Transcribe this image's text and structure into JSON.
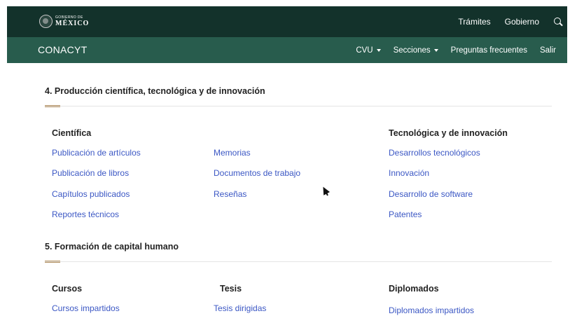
{
  "header": {
    "logo_small": "GOBIERNO DE",
    "logo_big": "MÉXICO",
    "links": [
      "Trámites",
      "Gobierno"
    ]
  },
  "subheader": {
    "brand": "CONACYT",
    "nav": [
      {
        "label": "CVU",
        "dropdown": true
      },
      {
        "label": "Secciones",
        "dropdown": true
      },
      {
        "label": "Preguntas frecuentes",
        "dropdown": false
      },
      {
        "label": "Salir",
        "dropdown": false
      }
    ]
  },
  "section4": {
    "title": "4. Producción científica, tecnológica y de innovación",
    "col_cientifica": "Científica",
    "col_tecnologica": "Tecnológica y de innovación",
    "links_col1": [
      "Publicación de artículos",
      "Publicación de libros",
      "Capítulos publicados",
      "Reportes técnicos"
    ],
    "links_col2": [
      "Memorias",
      "Documentos de trabajo",
      "Reseñas"
    ],
    "links_col3": [
      "Desarrollos tecnológicos",
      "Innovación",
      "Desarrollo de software",
      "Patentes"
    ]
  },
  "section5": {
    "title": "5. Formación de capital humano",
    "col1": "Cursos",
    "col2": "Tesis",
    "col3": "Diplomados",
    "link_col1": "Cursos impartidos",
    "link_col2": "Tesis dirigidas",
    "link_col3": "Diplomados impartidos"
  },
  "colors": {
    "topbar": "#13322b",
    "subbar": "#285c4d",
    "accent": "#b38e5d",
    "link": "#3b57c4"
  }
}
